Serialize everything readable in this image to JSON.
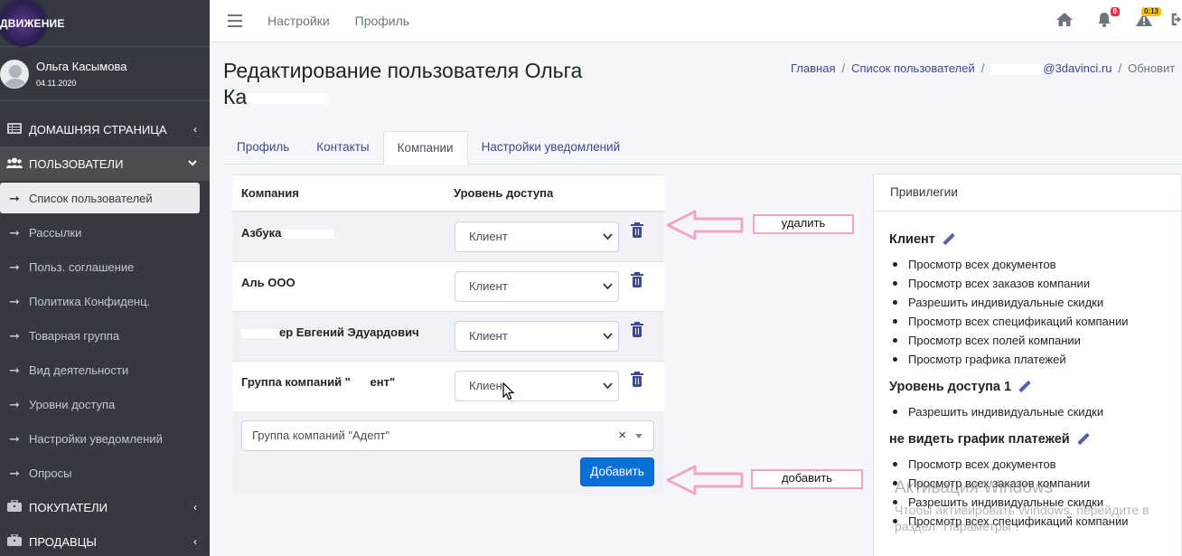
{
  "brand": {
    "name": "ДВИЖЕНИЕ"
  },
  "user": {
    "name": "Ольга Касымова",
    "date": "04.11.2020"
  },
  "sidebar": {
    "items": [
      {
        "label": "ДОМАШНЯЯ СТРАНИЦА",
        "icon": "list-icon",
        "chevron": "‹"
      },
      {
        "label": "ПОЛЬЗОВАТЕЛИ",
        "icon": "users-icon",
        "chevron": "⌄"
      },
      {
        "label": "Список пользователей"
      },
      {
        "label": "Рассылки"
      },
      {
        "label": "Польз. соглашение"
      },
      {
        "label": "Политика Конфиденц."
      },
      {
        "label": "Товарная группа"
      },
      {
        "label": "Вид деятельности"
      },
      {
        "label": "Уровни доступа"
      },
      {
        "label": "Настройки уведомлений"
      },
      {
        "label": "Опросы"
      },
      {
        "label": "ПОКУПАТЕЛИ",
        "icon": "briefcase-icon",
        "chevron": "‹"
      },
      {
        "label": "ПРОДАВЦЫ",
        "icon": "briefcase-icon",
        "chevron": "‹"
      }
    ]
  },
  "topbar": {
    "links": [
      "Настройки",
      "Профиль"
    ],
    "notifications_count": "0",
    "alerts_count": "0:13"
  },
  "page": {
    "title_line1": "Редактирование пользователя Ольга",
    "title_line2_prefix": "Ка"
  },
  "breadcrumb": {
    "home": "Главная",
    "users": "Список пользователей",
    "email_suffix": "@3davinci.ru",
    "current": "Обновит"
  },
  "tabs": [
    "Профиль",
    "Контакты",
    "Компании",
    "Настройки уведомлений"
  ],
  "companies": {
    "header_company": "Компания",
    "header_level": "Уровень доступа",
    "rows": [
      {
        "name": "Азбука",
        "level": "Клиент"
      },
      {
        "name": "Аль ООО",
        "level": "Клиент"
      },
      {
        "name": "ер Евгений Эдуардович",
        "level": "Клиент"
      },
      {
        "name": "Группа компаний \"      ент\"",
        "level": "Клиен"
      }
    ],
    "new_company_value": "Группа компаний \"Адепт\"",
    "add_button": "Добавить"
  },
  "annotations": {
    "delete": "удалить",
    "add": "добавить",
    "color": "#f0a6c8"
  },
  "privileges": {
    "title": "Привилегии",
    "groups": [
      {
        "name": "Клиент",
        "items": [
          "Просмотр всех документов",
          "Просмотр всех заказов компании",
          "Разрешить индивидуальные скидки",
          "Просмотр всех спецификаций компании",
          "Просмотр всех полей компании",
          "Просмотр графика платежей"
        ]
      },
      {
        "name": "Уровень доступа 1",
        "items": [
          "Разрешить индивидуальные скидки"
        ]
      },
      {
        "name": "не видеть график платежей",
        "items": [
          "Просмотр всех документов",
          "Просмотр всех заказов компании",
          "Разрешить индивидуальные скидки",
          "Просмотр всех спецификаций компании"
        ]
      }
    ]
  },
  "watermark": {
    "title": "Активация Windows",
    "subtitle": "Чтобы активировать Windows, перейдите в",
    "subtitle2": "раздел \"Параметры\"."
  },
  "colors": {
    "sidebar": "#343a40",
    "primary": "#0a6fd6",
    "link": "#3e4a8a"
  }
}
